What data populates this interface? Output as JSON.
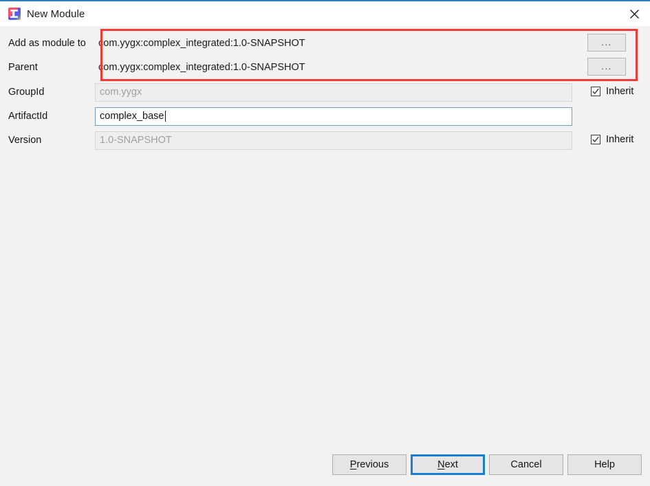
{
  "window": {
    "title": "New Module",
    "icon": "intellij-idea-icon",
    "close_icon": "close-icon",
    "accent": "#2d7cc0"
  },
  "annotation": {
    "color": "#ef3b33",
    "name": "red-highlight-box"
  },
  "form": {
    "rows": [
      {
        "label": "Add as module to",
        "value": "com.yygx:complex_integrated:1.0-SNAPSHOT",
        "state": "plain",
        "browse_label": "...",
        "has_browse": true,
        "has_inherit": false
      },
      {
        "label": "Parent",
        "value": "com.yygx:complex_integrated:1.0-SNAPSHOT",
        "state": "plain",
        "browse_label": "...",
        "has_browse": true,
        "has_inherit": false
      },
      {
        "label": "GroupId",
        "value": "com.yygx",
        "state": "disabled",
        "has_browse": false,
        "has_inherit": true,
        "inherit_label": "Inherit",
        "inherit_checked": true
      },
      {
        "label": "ArtifactId",
        "value": "complex_base",
        "state": "focused",
        "has_browse": false,
        "has_inherit": false
      },
      {
        "label": "Version",
        "value": "1.0-SNAPSHOT",
        "state": "disabled",
        "has_browse": false,
        "has_inherit": true,
        "inherit_label": "Inherit",
        "inherit_checked": true
      }
    ]
  },
  "footer": {
    "buttons": [
      {
        "label": "Previous",
        "mnemonic": "P",
        "default": false
      },
      {
        "label": "Next",
        "mnemonic": "N",
        "default": true
      },
      {
        "label": "Cancel",
        "mnemonic": "",
        "default": false
      },
      {
        "label": "Help",
        "mnemonic": "",
        "default": false
      }
    ],
    "focus_color": "#1a7fd4"
  }
}
